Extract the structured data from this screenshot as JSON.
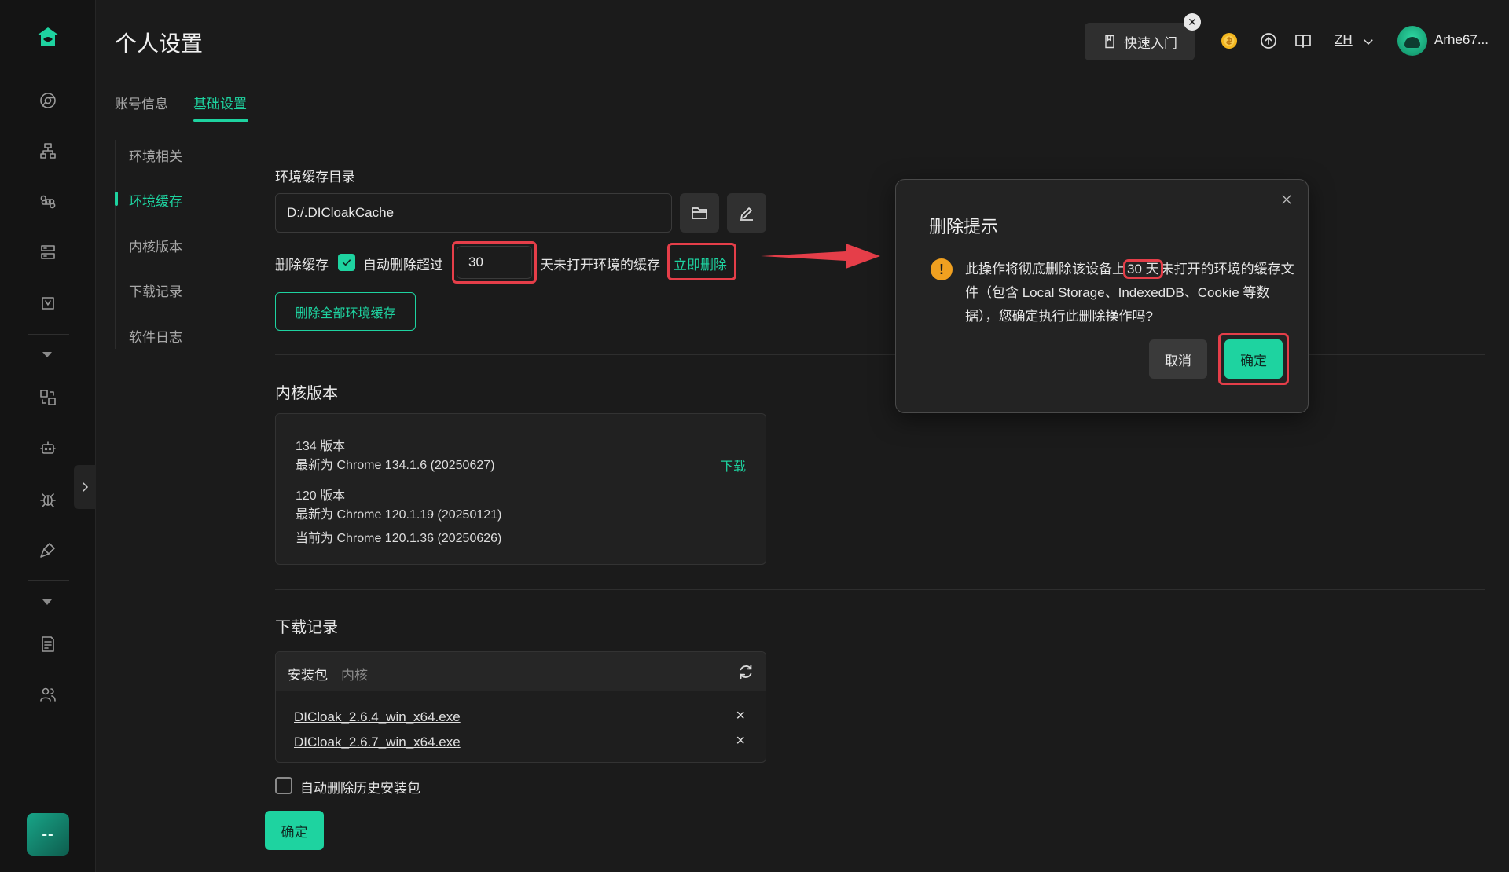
{
  "page": {
    "title": "个人设置"
  },
  "tabs": [
    {
      "label": "账号信息",
      "active": false
    },
    {
      "label": "基础设置",
      "active": true
    }
  ],
  "header": {
    "quick_start": "快速入门",
    "language": "ZH",
    "user_name": "Arhe67..."
  },
  "subnav": [
    {
      "label": "环境相关",
      "active": false
    },
    {
      "label": "环境缓存",
      "active": true
    },
    {
      "label": "内核版本",
      "active": false
    },
    {
      "label": "下载记录",
      "active": false
    },
    {
      "label": "软件日志",
      "active": false
    }
  ],
  "cache": {
    "dir_label": "环境缓存目录",
    "dir_value": "D:/.DICloakCache",
    "delete_label": "删除缓存",
    "auto_delete_checked": true,
    "auto_delete_label": "自动删除超过",
    "days_value": "30",
    "days_suffix": "天未打开环境的缓存",
    "delete_now": "立即删除",
    "delete_all_button": "删除全部环境缓存"
  },
  "kernel": {
    "title": "内核版本",
    "items": [
      {
        "version": "134 版本",
        "latest": "最新为 Chrome 134.1.6 (20250627)",
        "action": "下载"
      },
      {
        "version": "120 版本",
        "latest": "最新为 Chrome 120.1.19 (20250121)",
        "current": "当前为 Chrome 120.1.36 (20250626)"
      }
    ]
  },
  "downloads": {
    "title": "下载记录",
    "tab_active": "安装包",
    "tab_inactive": "内核",
    "files": [
      "DICloak_2.6.4_win_x64.exe",
      "DICloak_2.6.7_win_x64.exe"
    ],
    "remove_symbol": "×",
    "auto_delete_label": "自动删除历史安装包",
    "auto_delete_checked": false,
    "confirm": "确定"
  },
  "dialog": {
    "title": "删除提示",
    "warn_symbol": "!",
    "message_before": "此操作将彻底删除该设备上",
    "message_highlight": "30 天",
    "message_after": "未打开的环境的缓存文件（包含 Local Storage、IndexedDB、Cookie 等数据），您确定执行此删除操作吗?",
    "cancel": "取消",
    "ok": "确定"
  },
  "rail": {
    "bottom_label": "--"
  },
  "colors": {
    "accent": "#1ed3a0",
    "highlight": "#e53e49",
    "background": "#1b1b1b",
    "warning": "#f0a020"
  }
}
